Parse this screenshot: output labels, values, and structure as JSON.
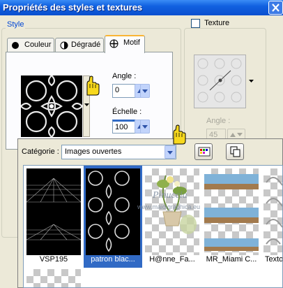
{
  "window": {
    "title": "Propriétés des styles et textures"
  },
  "style_group": {
    "legend": "Style",
    "tabs": [
      {
        "label": "Couleur",
        "icon": "solid-circle-icon"
      },
      {
        "label": "Dégradé",
        "icon": "half-circle-icon"
      },
      {
        "label": "Motif",
        "icon": "pattern-icon",
        "active": true
      }
    ],
    "angle_label": "Angle :",
    "angle_value": "0",
    "scale_label": "Échelle :",
    "scale_value": "100"
  },
  "texture_group": {
    "checkbox_label": "Texture",
    "checked": false,
    "angle_label": "Angle :",
    "angle_value": "45"
  },
  "category_popup": {
    "category_label": "Catégorie :",
    "category_value": "Images ouvertes",
    "thumbnails": [
      {
        "label": "VSP195"
      },
      {
        "label": "patron blac...",
        "selected": true
      },
      {
        "label": "H@nne_Fa..."
      },
      {
        "label": "MR_Miami C..."
      },
      {
        "label": "Texto_"
      }
    ]
  },
  "watermark": {
    "line1": "Pinuccia",
    "line2": "www.maidigraphica.eu"
  },
  "colors": {
    "title_bar": "#0a4fcf",
    "selection": "#316ac5",
    "group_legend": "#0046d5"
  }
}
